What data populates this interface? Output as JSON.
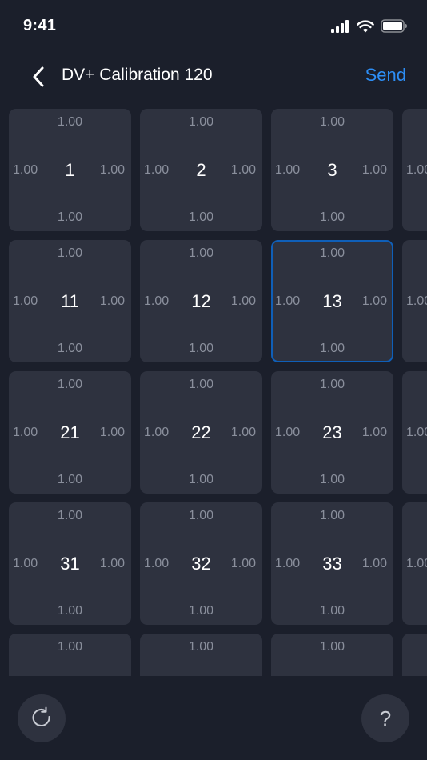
{
  "status": {
    "time": "9:41"
  },
  "nav": {
    "title": "DV+ Calibration 120",
    "send_label": "Send"
  },
  "grid": {
    "selected": "13",
    "rows": [
      [
        {
          "number": "1",
          "top": "1.00",
          "left": "1.00",
          "right": "1.00",
          "bottom": "1.00"
        },
        {
          "number": "2",
          "top": "1.00",
          "left": "1.00",
          "right": "1.00",
          "bottom": "1.00"
        },
        {
          "number": "3",
          "top": "1.00",
          "left": "1.00",
          "right": "1.00",
          "bottom": "1.00"
        },
        {
          "number": "",
          "top": "",
          "left": "1.00",
          "right": "",
          "bottom": ""
        }
      ],
      [
        {
          "number": "11",
          "top": "1.00",
          "left": "1.00",
          "right": "1.00",
          "bottom": "1.00"
        },
        {
          "number": "12",
          "top": "1.00",
          "left": "1.00",
          "right": "1.00",
          "bottom": "1.00"
        },
        {
          "number": "13",
          "top": "1.00",
          "left": "1.00",
          "right": "1.00",
          "bottom": "1.00"
        },
        {
          "number": "",
          "top": "",
          "left": "1.00",
          "right": "",
          "bottom": ""
        }
      ],
      [
        {
          "number": "21",
          "top": "1.00",
          "left": "1.00",
          "right": "1.00",
          "bottom": "1.00"
        },
        {
          "number": "22",
          "top": "1.00",
          "left": "1.00",
          "right": "1.00",
          "bottom": "1.00"
        },
        {
          "number": "23",
          "top": "1.00",
          "left": "1.00",
          "right": "1.00",
          "bottom": "1.00"
        },
        {
          "number": "",
          "top": "",
          "left": "1.00",
          "right": "",
          "bottom": ""
        }
      ],
      [
        {
          "number": "31",
          "top": "1.00",
          "left": "1.00",
          "right": "1.00",
          "bottom": "1.00"
        },
        {
          "number": "32",
          "top": "1.00",
          "left": "1.00",
          "right": "1.00",
          "bottom": "1.00"
        },
        {
          "number": "33",
          "top": "1.00",
          "left": "1.00",
          "right": "1.00",
          "bottom": "1.00"
        },
        {
          "number": "",
          "top": "",
          "left": "1.00",
          "right": "",
          "bottom": ""
        }
      ],
      [
        {
          "number": "",
          "top": "1.00",
          "left": "",
          "right": "",
          "bottom": ""
        },
        {
          "number": "",
          "top": "1.00",
          "left": "",
          "right": "",
          "bottom": ""
        },
        {
          "number": "",
          "top": "1.00",
          "left": "",
          "right": "",
          "bottom": ""
        },
        {
          "number": "",
          "top": "",
          "left": "",
          "right": "",
          "bottom": ""
        }
      ]
    ]
  },
  "footer": {
    "help_label": "?"
  },
  "icons": {
    "back": "chevron-left-icon",
    "refresh": "refresh-icon",
    "signal": "signal-icon",
    "wifi": "wifi-icon",
    "battery": "battery-icon"
  },
  "colors": {
    "background": "#1b1f2b",
    "cell": "#2e323f",
    "accent": "#2d8ef6",
    "selected_border": "#0f5fb8",
    "muted_text": "#8a8f9c"
  }
}
